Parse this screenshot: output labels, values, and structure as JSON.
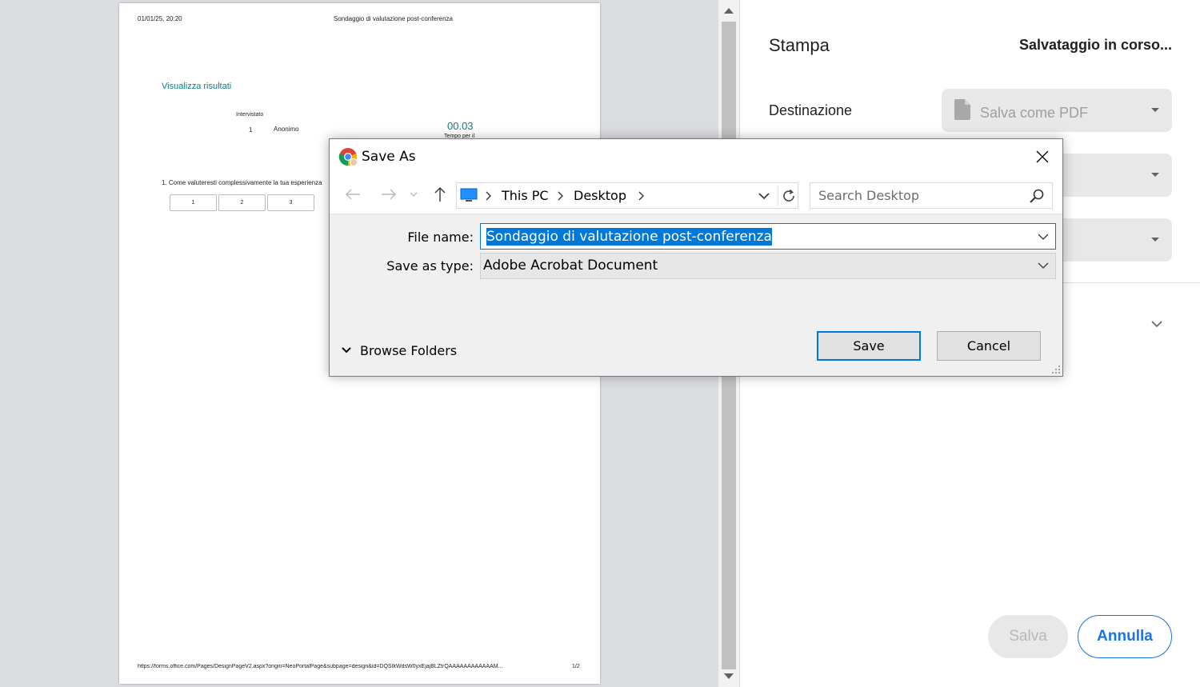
{
  "preview": {
    "header_date": "01/01/25, 20:20",
    "header_title": "Sondaggio di valutazione post-conferenza",
    "view_results_link": "Visualizza risultati",
    "respondent_header": "Intervistato",
    "respondent_number": "1",
    "respondent_name": "Anonimo",
    "time_value": "00.03",
    "time_label": "Tempo per il",
    "question_1": "1. Come valuteresti complessivamente la tua esperienza",
    "rating_options": [
      "1",
      "2",
      "3"
    ],
    "footer_url": "https://forms.office.com/Pages/DesignPageV2.aspx?origin=NeoPortalPage&subpage=design&id=DQSIkWdsW0yxEjajBLZtrQAAAAAAAAAAAAM...",
    "page_number": "1/2"
  },
  "print_panel": {
    "title": "Stampa",
    "status": "Salvataggio in corso...",
    "destination_label": "Destinazione",
    "destination_value": "Salva come PDF",
    "save_button": "Salva",
    "cancel_button": "Annulla",
    "accent_color": "#1a73e8"
  },
  "dialog": {
    "title": "Save As",
    "app_icon": "chrome-icon",
    "address": {
      "segments": [
        "This PC",
        "Desktop"
      ]
    },
    "search_placeholder": "Search Desktop",
    "file_name_label": "File name:",
    "file_name_value": "Sondaggio di valutazione post-conferenza",
    "save_type_label": "Save as type:",
    "save_type_value": "Adobe Acrobat Document",
    "browse_folders": "Browse Folders",
    "save_button": "Save",
    "cancel_button": "Cancel",
    "accent_color": "#0078d7"
  }
}
